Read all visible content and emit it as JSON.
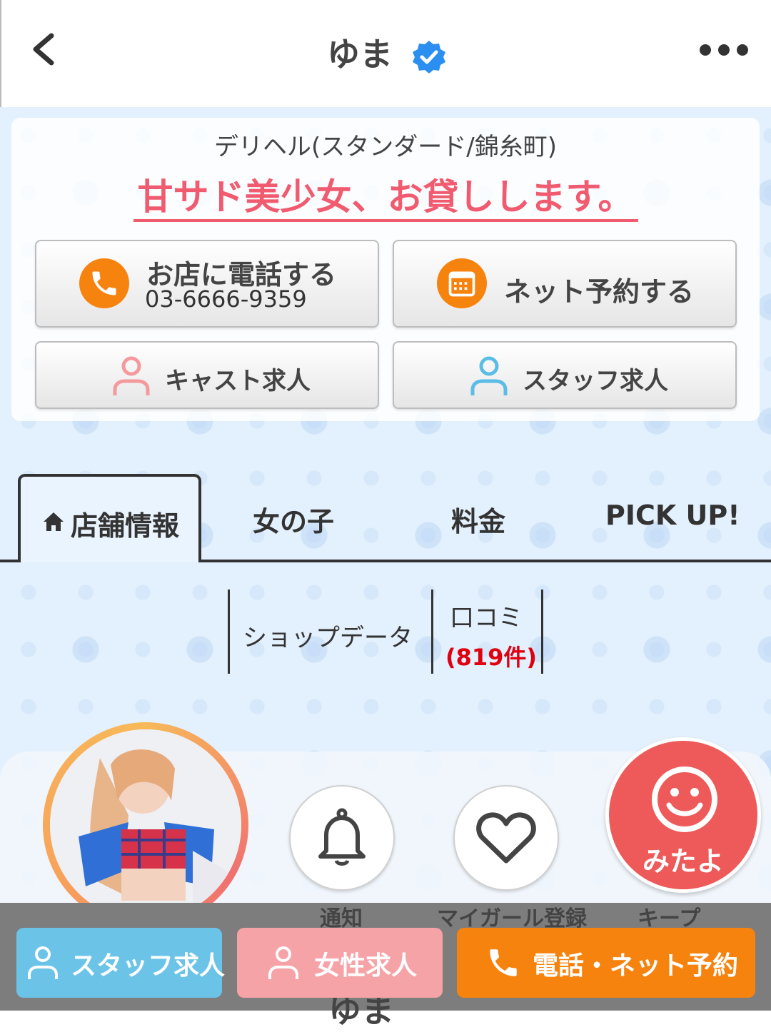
{
  "header": {
    "title": "ゆま",
    "back_icon": "back-chevron-icon",
    "verified_icon": "verified-badge-icon",
    "more_icon": "more-dots-icon"
  },
  "shop": {
    "category": "デリヘル(スタンダード/錦糸町)",
    "catchphrase": "甘サド美少女、お貸しします。"
  },
  "buttons": {
    "call_label": "お店に電話する",
    "call_number": "03-6666-9359",
    "net_reserve_label": "ネット予約する",
    "cast_recruit_label": "キャスト求人",
    "staff_recruit_label": "スタッフ求人"
  },
  "tabs": [
    {
      "label": "店舗情報",
      "active": true
    },
    {
      "label": "女の子",
      "active": false
    },
    {
      "label": "料金",
      "active": false
    },
    {
      "label": "PICK UP!",
      "active": false
    }
  ],
  "subnav": {
    "shop_data": "ショップデータ",
    "reviews": "口コミ",
    "reviews_count": "(819件)"
  },
  "bottom": {
    "notify_label": "通知",
    "mygirl_label": "マイガール登録",
    "keep_label": "キープ",
    "mitayo_label": "みたよ",
    "ghost_title": "ゆま"
  },
  "cta": {
    "staff": "スタッフ求人",
    "women": "女性求人",
    "call": "電話・ネット予約"
  },
  "colors": {
    "accent_orange": "#f7830f",
    "catch_pink": "#f05b6f",
    "staff_blue": "#6cc3e8",
    "women_pink": "#f6a3a8",
    "mitayo_red": "#ee5a5a",
    "review_count_red": "#e0000f"
  }
}
